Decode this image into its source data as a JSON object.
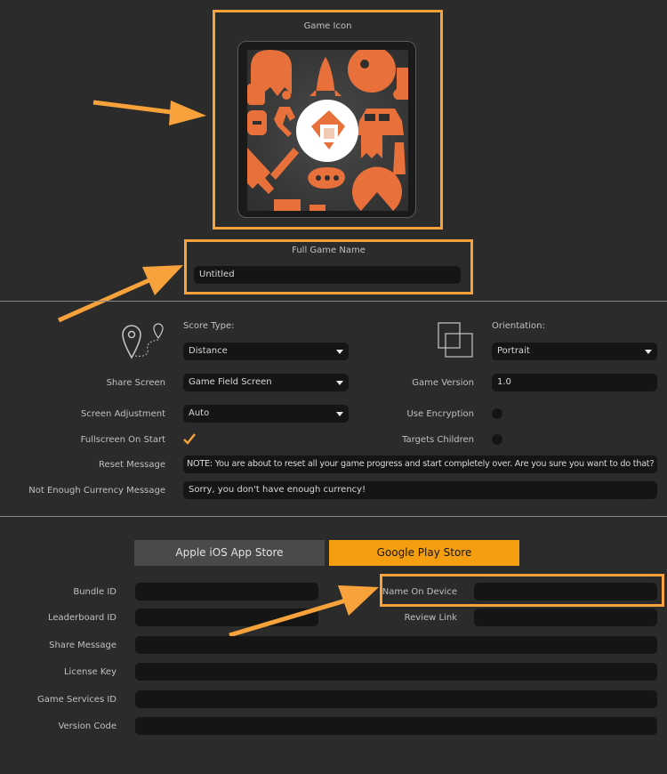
{
  "icon_section": {
    "title": "Game Icon"
  },
  "game_name": {
    "label": "Full Game Name",
    "value": "Untitled"
  },
  "settings": {
    "score_type": {
      "label": "Score Type:",
      "value": "Distance"
    },
    "orientation": {
      "label": "Orientation:",
      "value": "Portrait"
    },
    "share_screen": {
      "label": "Share Screen",
      "value": "Game Field Screen"
    },
    "game_version": {
      "label": "Game Version",
      "value": "1.0"
    },
    "screen_adjustment": {
      "label": "Screen Adjustment",
      "value": "Auto"
    },
    "use_encryption": {
      "label": "Use Encryption",
      "checked": false
    },
    "fullscreen_on_start": {
      "label": "Fullscreen On Start",
      "checked": true
    },
    "targets_children": {
      "label": "Targets Children",
      "checked": false
    },
    "reset_message": {
      "label": "Reset Message",
      "value": "NOTE:  You are about to reset all your game progress and start completely over.  Are you sure you want to do that?"
    },
    "not_enough_currency": {
      "label": "Not Enough Currency Message",
      "value": "Sorry, you don't have enough currency!"
    }
  },
  "store_tabs": [
    {
      "label": "Apple iOS App Store",
      "active": false
    },
    {
      "label": "Google Play Store",
      "active": true
    }
  ],
  "store_fields": {
    "bundle_id": {
      "label": "Bundle ID",
      "value": ""
    },
    "name_on_device": {
      "label": "Name On Device",
      "value": ""
    },
    "leaderboard_id": {
      "label": "Leaderboard ID",
      "value": ""
    },
    "review_link": {
      "label": "Review Link",
      "value": ""
    },
    "share_message": {
      "label": "Share Message",
      "value": ""
    },
    "license_key": {
      "label": "License Key",
      "value": ""
    },
    "game_services_id": {
      "label": "Game Services ID",
      "value": ""
    },
    "version_code": {
      "label": "Version Code",
      "value": ""
    }
  },
  "colors": {
    "accent": "#f7a23a",
    "background": "#2b2b2b",
    "field": "#151515",
    "active_tab": "#f59e10",
    "inactive_tab": "#4a4a4a",
    "icon_orange": "#e8703a"
  }
}
